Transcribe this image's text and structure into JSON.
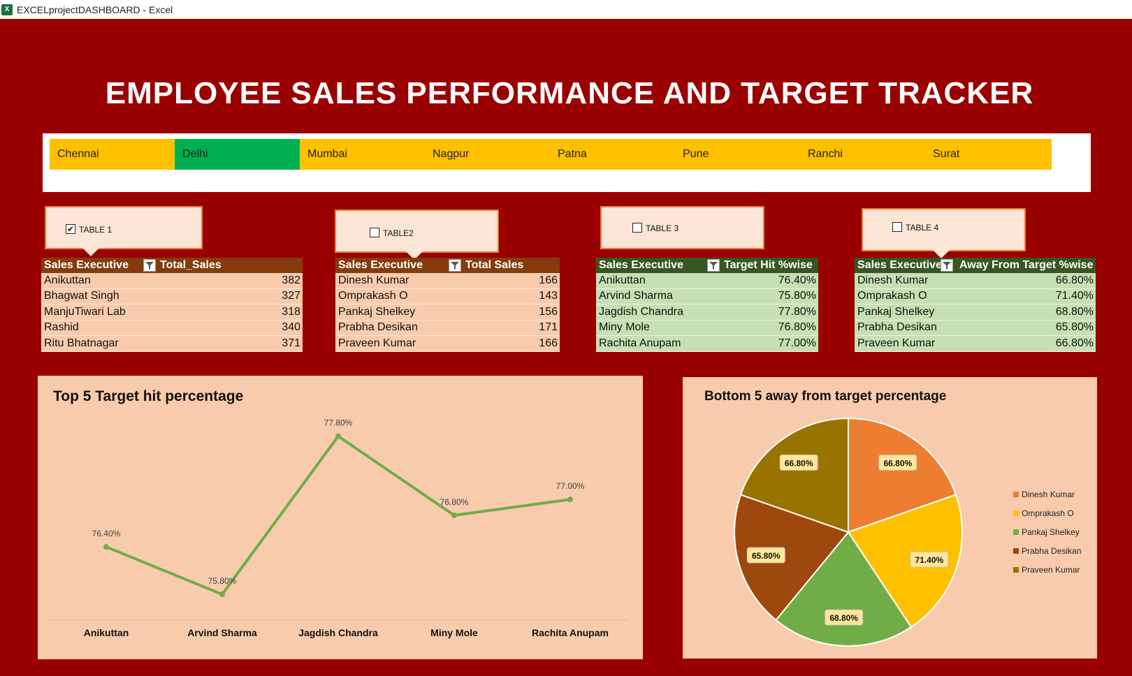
{
  "window": {
    "title": "EXCELprojectDASHBOARD - Excel",
    "icon": "excel-icon"
  },
  "dashboard": {
    "title": "EMPLOYEE SALES PERFORMANCE AND TARGET TRACKER"
  },
  "slicer": {
    "items": [
      "Chennai",
      "Delhi",
      "Mumbai",
      "Nagpur",
      "Patna",
      "Pune",
      "Ranchi",
      "Surat"
    ],
    "selected": "Delhi"
  },
  "callouts": [
    {
      "label": "TABLE 1",
      "checked": true,
      "check_mark": "✔"
    },
    {
      "label": "TABLE2",
      "checked": false,
      "check_mark": ""
    },
    {
      "label": "TABLE 3",
      "checked": false,
      "check_mark": ""
    },
    {
      "label": "TABLE 4",
      "checked": false,
      "check_mark": ""
    }
  ],
  "tables": [
    {
      "headers": [
        "Sales Executive",
        "Total_Sales"
      ],
      "rows": [
        [
          "Anikuttan",
          "382"
        ],
        [
          "Bhagwat Singh",
          "327"
        ],
        [
          "ManjuTiwari Lab",
          "318"
        ],
        [
          "Rashid",
          "340"
        ],
        [
          "Ritu Bhatnagar",
          "371"
        ]
      ]
    },
    {
      "headers": [
        "Sales Executive",
        "Total  Sales"
      ],
      "rows": [
        [
          "Dinesh Kumar",
          "166"
        ],
        [
          "Omprakash O",
          "143"
        ],
        [
          "Pankaj Shelkey",
          "156"
        ],
        [
          "Prabha Desikan",
          "171"
        ],
        [
          "Praveen Kumar",
          "166"
        ]
      ]
    },
    {
      "headers": [
        "Sales Executive",
        "Target Hit %wise"
      ],
      "rows": [
        [
          "Anikuttan",
          "76.40%"
        ],
        [
          "Arvind Sharma",
          "75.80%"
        ],
        [
          "Jagdish Chandra",
          "77.80%"
        ],
        [
          "Miny Mole",
          "76.80%"
        ],
        [
          "Rachita Anupam",
          "77.00%"
        ]
      ]
    },
    {
      "headers": [
        "Sales Executive",
        "Away From Target %wise"
      ],
      "rows": [
        [
          "Dinesh Kumar",
          "66.80%"
        ],
        [
          "Omprakash O",
          "71.40%"
        ],
        [
          "Pankaj Shelkey",
          "68.80%"
        ],
        [
          "Prabha Desikan",
          "65.80%"
        ],
        [
          "Praveen Kumar",
          "66.80%"
        ]
      ]
    }
  ],
  "colors": {
    "background": "#990000",
    "slicer_item": "#ffc000",
    "slicer_selected": "#00b050",
    "line": "#70ad47",
    "pie": [
      "#ed7d31",
      "#ffc000",
      "#70ad47",
      "#9e480e",
      "#997300"
    ]
  },
  "chart_data": [
    {
      "type": "line",
      "title": "Top 5 Target hit  percentage",
      "categories": [
        "Anikuttan",
        "Arvind Sharma",
        "Jagdish Chandra",
        "Miny Mole",
        "Rachita Anupam"
      ],
      "values": [
        76.4,
        75.8,
        77.8,
        76.8,
        77.0
      ],
      "data_labels": [
        "76.40%",
        "75.80%",
        "77.80%",
        "76.80%",
        "77.00%"
      ],
      "ylim": [
        75.5,
        78.0
      ],
      "grid": false,
      "legend": "none"
    },
    {
      "type": "pie",
      "title": "Bottom 5 away from target percentage",
      "categories": [
        "Dinesh Kumar",
        "Omprakash O",
        "Pankaj Shelkey",
        "Prabha Desikan",
        "Praveen Kumar"
      ],
      "values": [
        66.8,
        71.4,
        68.8,
        65.8,
        66.8
      ],
      "data_labels": [
        "66.80%",
        "71.40%",
        "68.80%",
        "65.80%",
        "66.80%"
      ],
      "legend": "right"
    }
  ]
}
